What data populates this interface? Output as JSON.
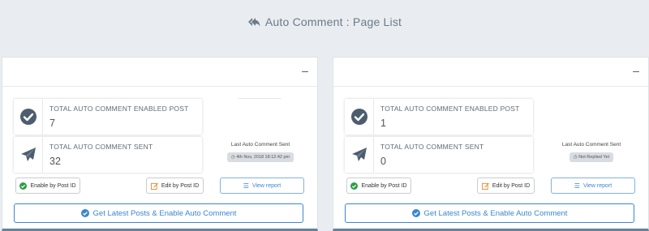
{
  "header": {
    "title": "Auto Comment : Page List",
    "icon": "reply-all-icon"
  },
  "panels": [
    {
      "enabled_label": "TOTAL AUTO COMMENT ENABLED POST",
      "enabled_count": "7",
      "sent_label": "TOTAL AUTO COMMENT SENT",
      "sent_count": "32",
      "last_sent_label": "Last Auto Comment Sent",
      "last_sent_value": "4th Nov, 2018 18:12:42 pm",
      "enable_btn": "Enable by Post ID",
      "edit_btn": "Edit by Post ID",
      "view_btn": "View report",
      "main_btn": "Get Latest Posts & Enable Auto Comment"
    },
    {
      "enabled_label": "TOTAL AUTO COMMENT ENABLED POST",
      "enabled_count": "1",
      "sent_label": "TOTAL AUTO COMMENT SENT",
      "sent_count": "0",
      "last_sent_label": "Last Auto Comment Sent",
      "last_sent_value": "Not Replied Yet",
      "enable_btn": "Enable by Post ID",
      "edit_btn": "Edit by Post ID",
      "view_btn": "View report",
      "main_btn": "Get Latest Posts & Enable Auto Comment"
    }
  ],
  "colors": {
    "accent": "#3b86d1",
    "icon": "#4d5d6e",
    "success": "#2e9e46",
    "warning": "#e8892b"
  }
}
